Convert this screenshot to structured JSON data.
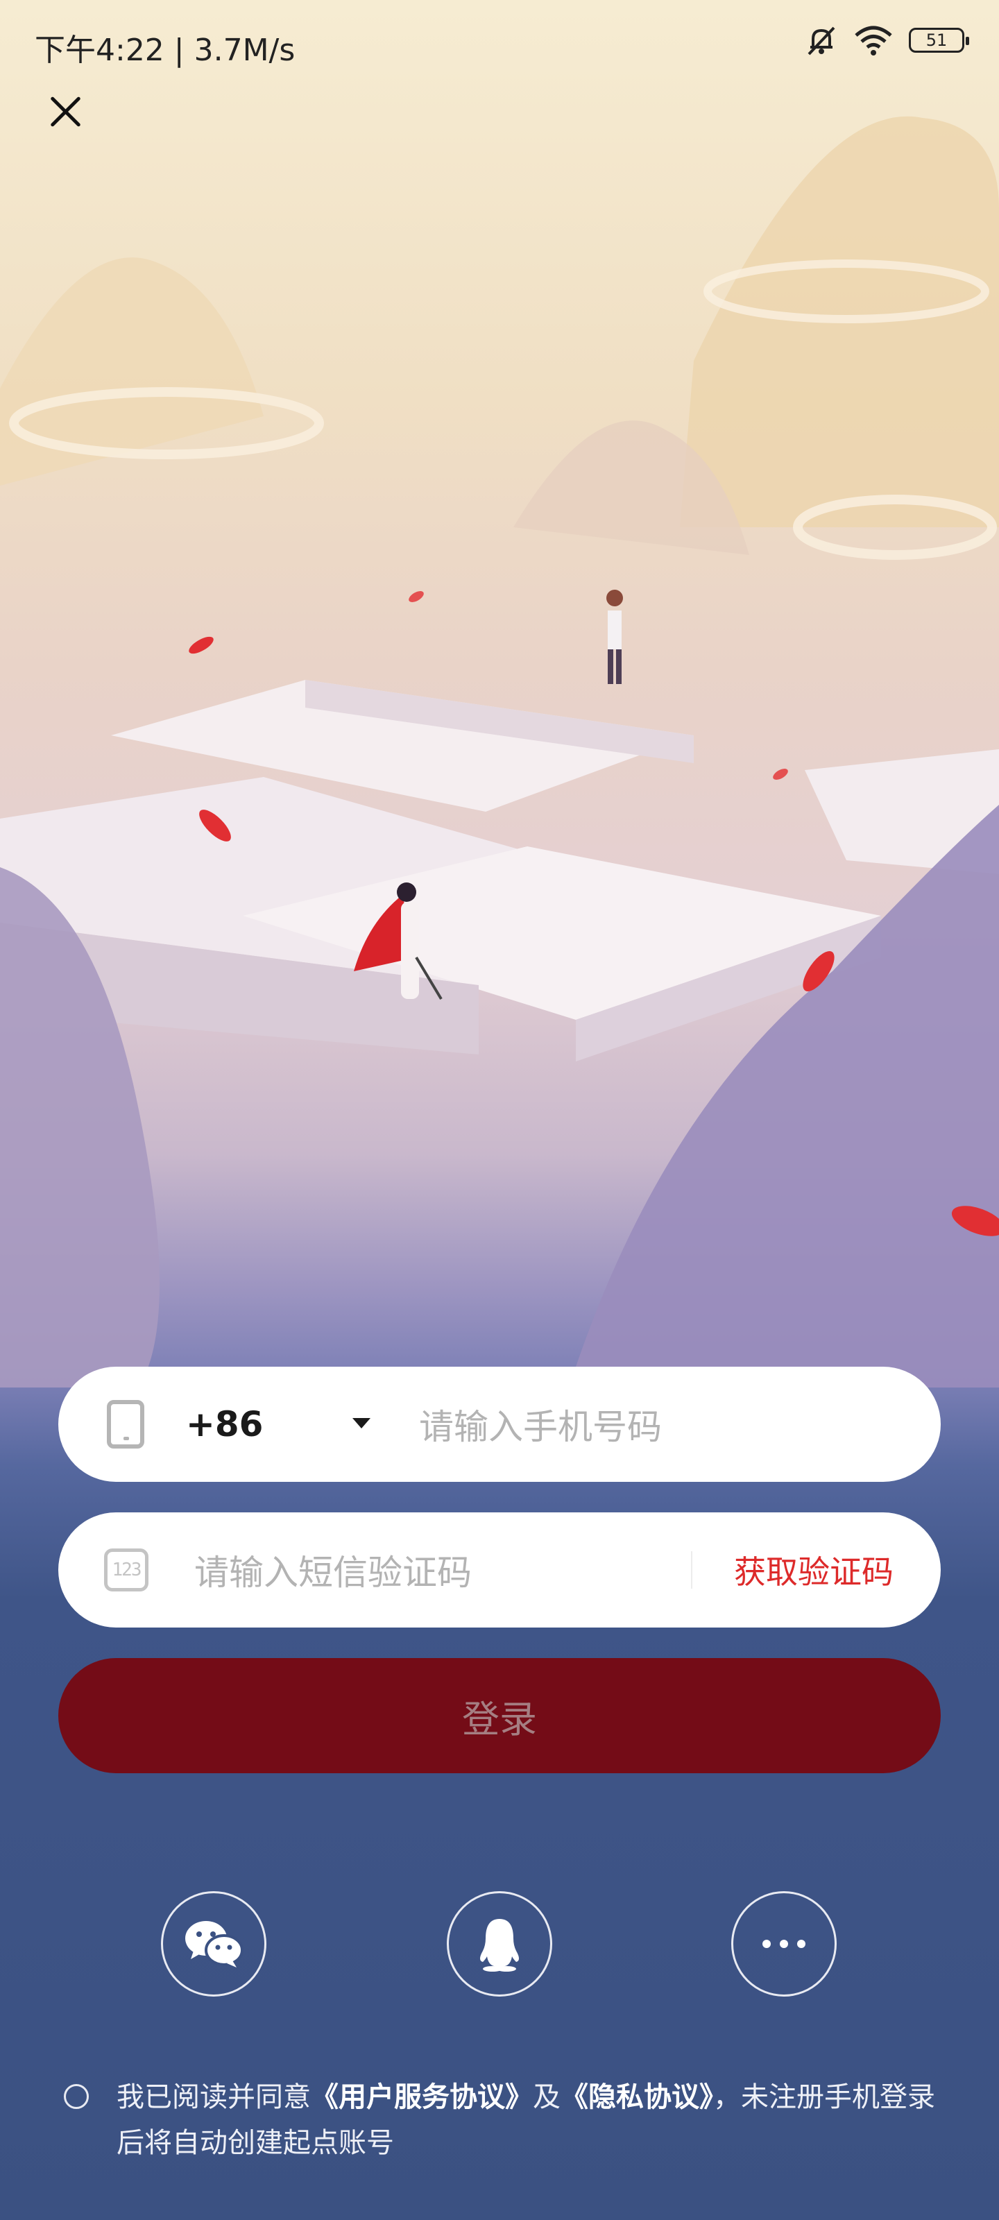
{
  "status_bar": {
    "time_speed": "下午4:22 | 3.7M/s",
    "battery": "51",
    "icons": [
      "bell-off-icon",
      "wifi-icon",
      "battery-icon"
    ]
  },
  "close_icon": "close-icon",
  "phone_field": {
    "icon": "phone-icon",
    "country_code": "+86",
    "placeholder": "请输入手机号码"
  },
  "sms_field": {
    "icon": "number-123-icon",
    "icon_text": "123",
    "placeholder": "请输入短信验证码",
    "get_code_label": "获取验证码"
  },
  "login_button": {
    "label": "登录"
  },
  "social_login": [
    {
      "icon": "wechat-icon"
    },
    {
      "icon": "qq-icon"
    },
    {
      "icon": "more-icon"
    }
  ],
  "agreement": {
    "prefix": "我已阅读并同意",
    "user_agreement": "《用户服务协议》",
    "and": "及",
    "privacy_agreement": "《隐私协议》",
    "suffix": "，未注册手机登录后将自动创建起点账号"
  },
  "colors": {
    "accent_red": "#dd2a2a",
    "login_button_bg": "#740c17",
    "bottom_bg": "#3b5182"
  }
}
